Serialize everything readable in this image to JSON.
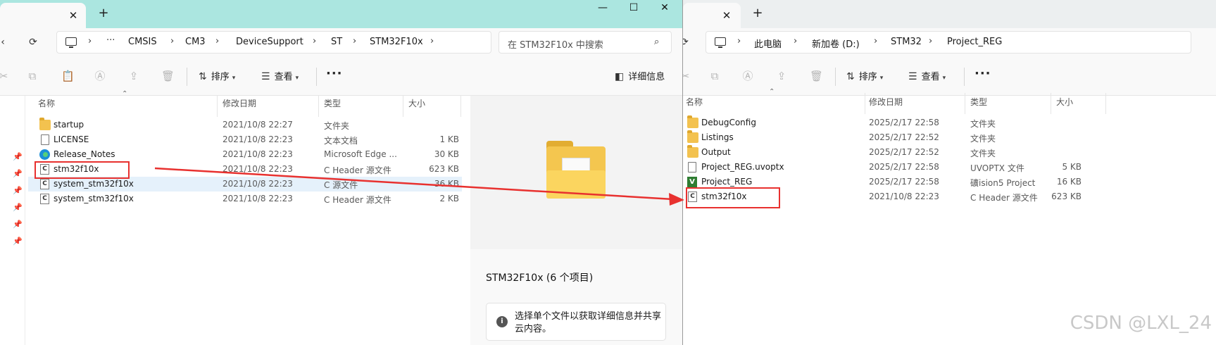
{
  "left": {
    "breadcrumb": [
      "CMSIS",
      "CM3",
      "DeviceSupport",
      "ST",
      "STM32F10x"
    ],
    "search_placeholder": "在 STM32F10x 中搜索",
    "toolbar": {
      "sort": "排序",
      "view": "查看",
      "details": "详细信息",
      "more": "···"
    },
    "columns": {
      "name": "名称",
      "date": "修改日期",
      "type": "类型",
      "size": "大小"
    },
    "files": [
      {
        "name": "startup",
        "date": "2021/10/8 22:27",
        "type": "文件夹",
        "size": "",
        "icon": "folder-icon"
      },
      {
        "name": "LICENSE",
        "date": "2021/10/8 22:23",
        "type": "文本文档",
        "size": "1 KB",
        "icon": "document-icon"
      },
      {
        "name": "Release_Notes",
        "date": "2021/10/8 22:23",
        "type": "Microsoft Edge ...",
        "size": "30 KB",
        "icon": "edge-icon"
      },
      {
        "name": "stm32f10x",
        "date": "2021/10/8 22:23",
        "type": "C Header 源文件",
        "size": "623 KB",
        "icon": "c-header-icon"
      },
      {
        "name": "system_stm32f10x",
        "date": "2021/10/8 22:23",
        "type": "C 源文件",
        "size": "36 KB",
        "icon": "c-source-icon"
      },
      {
        "name": "system_stm32f10x",
        "date": "2021/10/8 22:23",
        "type": "C Header 源文件",
        "size": "2 KB",
        "icon": "c-header-icon"
      }
    ],
    "preview": {
      "title": "STM32F10x (6 个项目)",
      "info": "选择单个文件以获取详细信息并共享云内容。"
    }
  },
  "right": {
    "breadcrumb": [
      "此电脑",
      "新加卷 (D:)",
      "STM32",
      "Project_REG"
    ],
    "toolbar": {
      "sort": "排序",
      "view": "查看",
      "more": "···"
    },
    "columns": {
      "name": "名称",
      "date": "修改日期",
      "type": "类型",
      "size": "大小"
    },
    "files": [
      {
        "name": "DebugConfig",
        "date": "2025/2/17 22:58",
        "type": "文件夹",
        "size": "",
        "icon": "folder-icon"
      },
      {
        "name": "Listings",
        "date": "2025/2/17 22:52",
        "type": "文件夹",
        "size": "",
        "icon": "folder-icon"
      },
      {
        "name": "Output",
        "date": "2025/2/17 22:52",
        "type": "文件夹",
        "size": "",
        "icon": "folder-icon"
      },
      {
        "name": "Project_REG.uvoptx",
        "date": "2025/2/17 22:58",
        "type": "UVOPTX 文件",
        "size": "5 KB",
        "icon": "document-icon"
      },
      {
        "name": "Project_REG",
        "date": "2025/2/17 22:58",
        "type": "礦ision5 Project",
        "size": "16 KB",
        "icon": "keil-project-icon"
      },
      {
        "name": "stm32f10x",
        "date": "2021/10/8 22:23",
        "type": "C Header 源文件",
        "size": "623 KB",
        "icon": "c-header-icon"
      }
    ]
  },
  "watermark": "CSDN @LXL_24",
  "colors": {
    "annotation_red": "#e8312f",
    "left_titlebar": "#abe6e0",
    "selection": "#e5f1fb"
  }
}
